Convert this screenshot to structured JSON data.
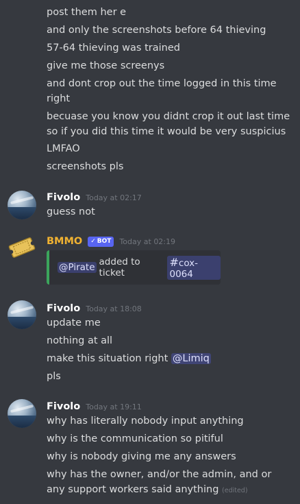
{
  "intro_lines": [
    "post them her e",
    "and only the screenshots before 64 thieving",
    "57-64 thieving was trained",
    "give me those screenys",
    "and dont crop out the time logged in this time right",
    "becuase you know you didnt crop it out last time so if you did this time it would be very suspicius",
    "LMFAO",
    "screenshots pls"
  ],
  "msg1": {
    "author": "Fivolo",
    "time": "Today at 02:17",
    "lines": [
      "guess not"
    ]
  },
  "bot_msg": {
    "author": "BMMO",
    "tag": "BOT",
    "time": "Today at 02:19",
    "embed": {
      "mention": "@Pirate",
      "text": "added to ticket",
      "channel": "cox-0064"
    }
  },
  "msg2": {
    "author": "Fivolo",
    "time": "Today at 18:08",
    "lines": [
      "update me",
      "nothing at all",
      "make this situation right",
      "pls"
    ],
    "mention": "@Limiq"
  },
  "msg3": {
    "author": "Fivolo",
    "time": "Today at 19:11",
    "lines": [
      "why has literally nobody input anything",
      "why is the communication so pitiful",
      "why is nobody giving me any answers",
      "why has the owner, and/or the admin, and or any support workers said anything"
    ],
    "edited": "(edited)"
  },
  "colors": {
    "background": "#36393f",
    "bot_name": "#f0b232",
    "embed_border": "#3ba55c",
    "bot_tag": "#5865f2"
  }
}
